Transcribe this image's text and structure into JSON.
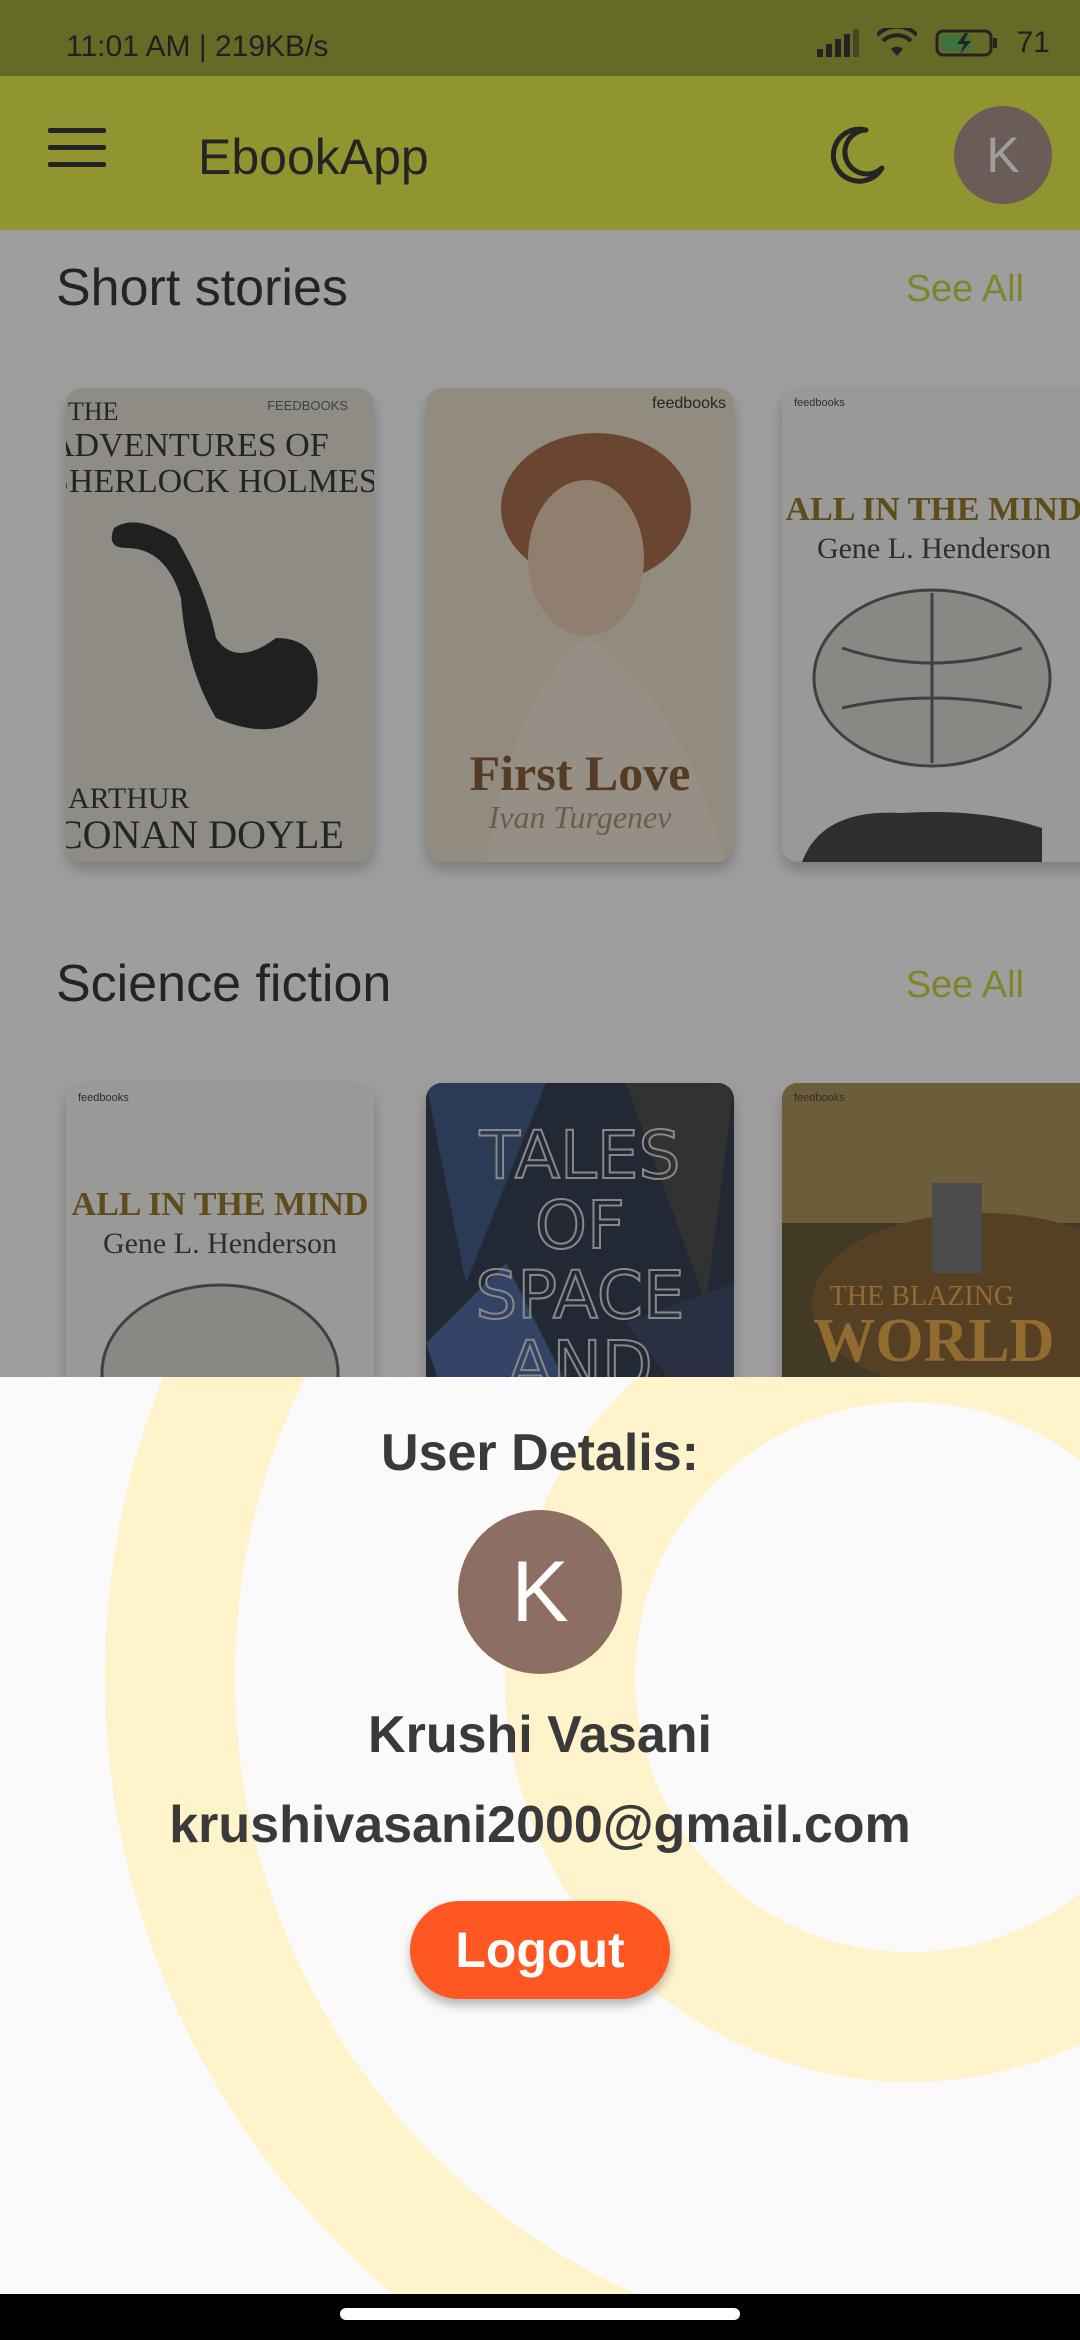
{
  "status_bar": {
    "time": "11:01 AM | 219KB/s",
    "battery": "71"
  },
  "app_bar": {
    "title": "EbookApp",
    "avatar_letter": "K"
  },
  "sections": [
    {
      "title": "Short stories",
      "see_all": "See All",
      "books": [
        {
          "title_lines": [
            "THE",
            "ADVENTURES OF",
            "SHERLOCK HOLMES"
          ],
          "author_lines": [
            "ARTHUR",
            "CONAN DOYLE"
          ],
          "badge": "FEEDBOOKS"
        },
        {
          "title": "First Love",
          "author": "Ivan Turgenev",
          "badge": "feedbooks"
        },
        {
          "title": "ALL IN THE MIND",
          "author": "Gene L. Henderson",
          "badge": "feedbooks"
        }
      ]
    },
    {
      "title": "Science fiction",
      "see_all": "See All",
      "books": [
        {
          "title": "ALL IN THE MIND",
          "author": "Gene L. Henderson",
          "badge": "feedbooks"
        },
        {
          "title_lines": [
            "TALES",
            "OF",
            "SPACE",
            "AND"
          ]
        },
        {
          "title_lines": [
            "THE BLAZING",
            "WORLD"
          ],
          "badge": "feedbooks"
        }
      ]
    }
  ],
  "sheet": {
    "title": "User Detalis:",
    "avatar_letter": "K",
    "name": "Krushi Vasani",
    "email": "krushivasani2000@gmail.com",
    "logout_label": "Logout"
  },
  "colors": {
    "app_bar": "#e6ef36",
    "accent": "#c8d130",
    "logout": "#ff5722",
    "avatar": "#8d6e63",
    "deco_ring": "#fff3cc"
  },
  "icons": [
    "menu-icon",
    "moon-icon",
    "signal-icon",
    "wifi-icon",
    "battery-icon"
  ]
}
